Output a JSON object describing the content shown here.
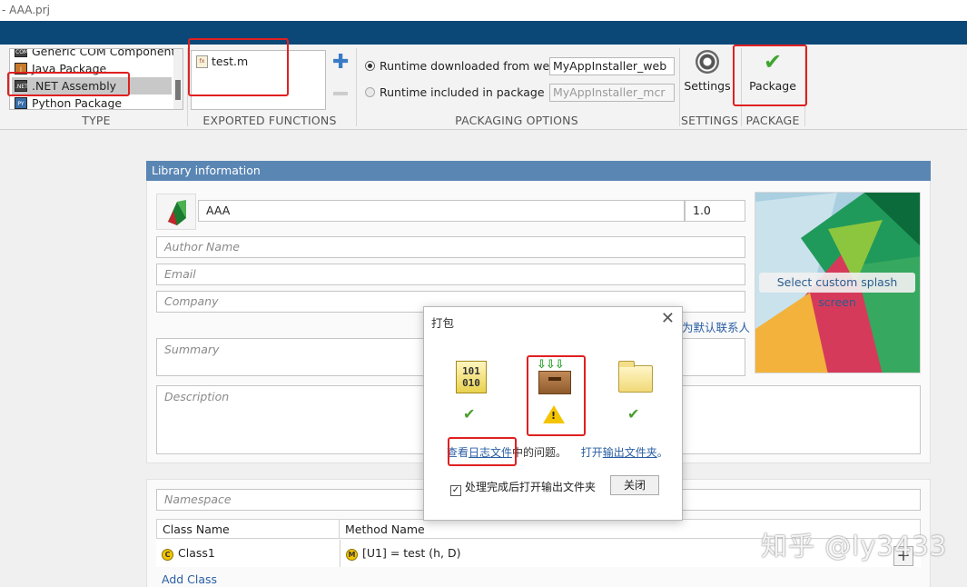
{
  "window": {
    "title": "- AAA.prj"
  },
  "toolstrip": {
    "type": {
      "label": "TYPE",
      "items": [
        "Generic COM Component",
        "Java Package",
        ".NET Assembly",
        "Python Package"
      ],
      "selected": ".NET Assembly"
    },
    "exported": {
      "label": "EXPORTED FUNCTIONS",
      "items": [
        "test.m"
      ]
    },
    "packaging": {
      "label": "PACKAGING OPTIONS",
      "web_label": "Runtime downloaded from web",
      "web_value": "MyAppInstaller_web",
      "mcr_label": "Runtime included in package",
      "mcr_value": "MyAppInstaller_mcr"
    },
    "settings": {
      "label": "SETTINGS",
      "button": "Settings"
    },
    "package": {
      "label": "PACKAGE",
      "button": "Package"
    }
  },
  "library": {
    "header": "Library information",
    "name": "AAA",
    "version": "1.0",
    "author_placeholder": "Author Name",
    "email_placeholder": "Email",
    "company_placeholder": "Company",
    "summary_placeholder": "Summary",
    "description_placeholder": "Description",
    "contact_link": "为默认联系人",
    "splash_label": "Select custom splash screen"
  },
  "classes": {
    "namespace_placeholder": "Namespace",
    "col_class": "Class Name",
    "col_method": "Method Name",
    "row_class": "Class1",
    "row_method": "[U1] = test (h, D)",
    "add_class": "Add Class"
  },
  "dialog": {
    "title": "打包",
    "binary_text": "101\n010",
    "link_prefix": "查看",
    "link_log": "日志文件",
    "link_mid": "中的问题。",
    "link_open": "打开",
    "link_output": "输出文件夹",
    "link_end": "。",
    "checkbox_label": "处理完成后打开输出文件夹",
    "close_button": "关闭"
  },
  "watermark": "知乎 @ly3433",
  "colors": {
    "accent": "#0b4777",
    "header": "#5a86b4",
    "link": "#2a5ea3",
    "highlight": "#e02020"
  }
}
